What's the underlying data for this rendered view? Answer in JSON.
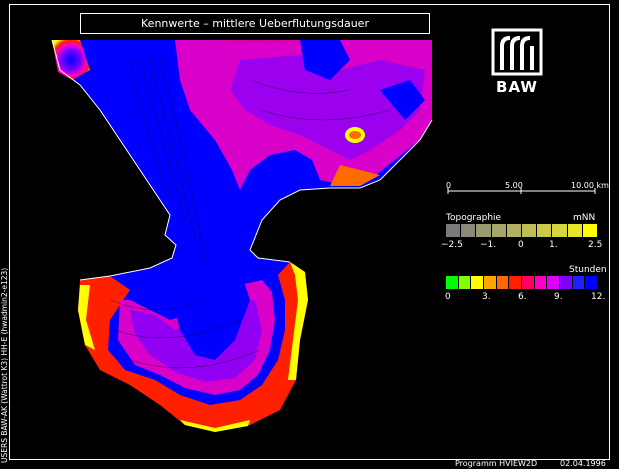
{
  "title": "Kennwerte – mittlere Ueberflutungsdauer",
  "logo_text": "BAW",
  "scale_bar": {
    "labels": [
      "0",
      "5.00",
      "10.00 km"
    ]
  },
  "topography_legend": {
    "title": "Topographie",
    "unit": "mNN",
    "colors": [
      "#7a7a7a",
      "#8a8a7a",
      "#9a9a72",
      "#a6a66a",
      "#b2b260",
      "#bebe56",
      "#caca4a",
      "#d6d63e",
      "#e6e62a",
      "#ffff00"
    ],
    "ticks": [
      "−2.5",
      "−1.",
      "0",
      "1.",
      "2.5"
    ]
  },
  "duration_legend": {
    "title": "Stunden",
    "colors": [
      "#00ff00",
      "#7fff00",
      "#ffff00",
      "#ffa500",
      "#ff6a00",
      "#ff2000",
      "#ff0060",
      "#ff00c0",
      "#e000ff",
      "#8000ff",
      "#2020ff",
      "#0000ff"
    ],
    "ticks": [
      "0",
      "3.",
      "6.",
      "9.",
      "12."
    ]
  },
  "side_text": "USERS BAW-AK (Wattrot K3) HH-E (hwadmin2-e123)",
  "footer": {
    "program": "Programm HVIEW2D",
    "date": "02.04.1996"
  }
}
